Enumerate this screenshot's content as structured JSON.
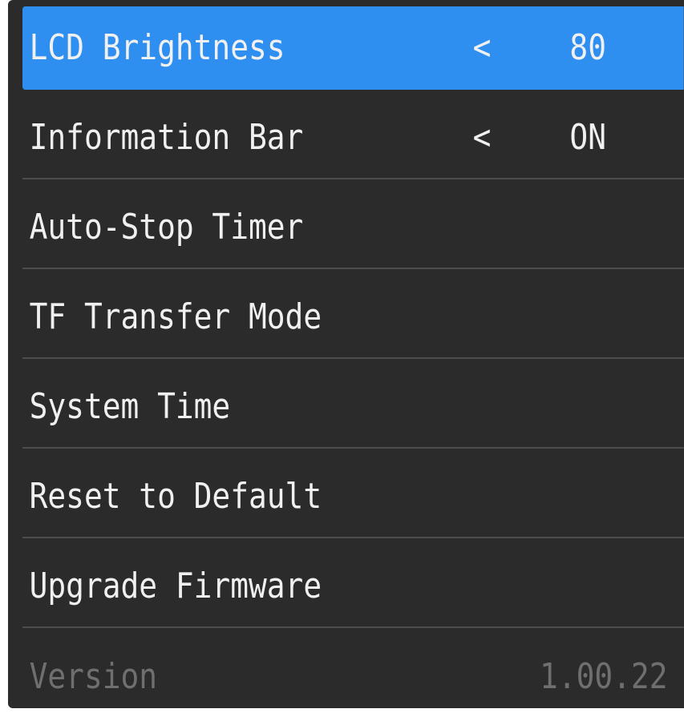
{
  "menu": {
    "items": [
      {
        "label": "LCD Brightness",
        "left_arrow": "<",
        "value": "80",
        "right_arrow": ">"
      },
      {
        "label": "Information Bar",
        "left_arrow": "<",
        "value": "ON",
        "right_arrow": ">"
      },
      {
        "label": "Auto-Stop Timer"
      },
      {
        "label": "TF Transfer Mode"
      },
      {
        "label": "System Time"
      },
      {
        "label": "Reset to Default"
      },
      {
        "label": "Upgrade Firmware"
      }
    ],
    "version": {
      "label": "Version",
      "value": "1.00.22"
    }
  },
  "colors": {
    "background": "#2b2b2b",
    "selected": "#2e8ff0",
    "text": "#f0f0f0",
    "disabled_text": "#6f6f6f",
    "divider": "#4d4d4d"
  }
}
